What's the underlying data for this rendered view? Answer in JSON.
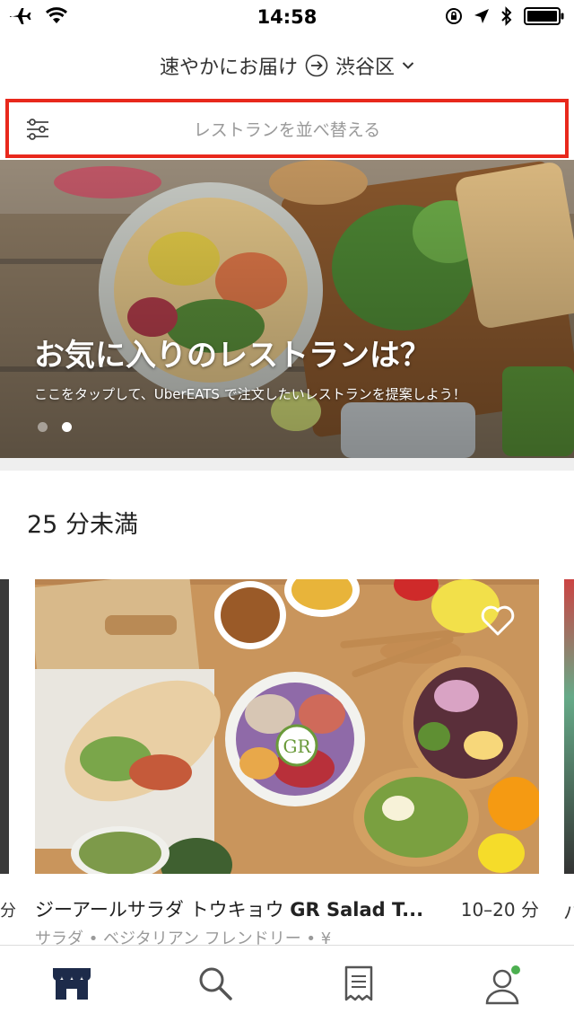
{
  "status_bar": {
    "time": "14:58"
  },
  "header": {
    "delivery_label": "速やかにお届け",
    "location": "渋谷区"
  },
  "search": {
    "placeholder": "レストランを並べ替える"
  },
  "banner": {
    "title": "お気に入りのレストランは？",
    "subtitle": "ここをタップして、UberEATS で注文したいレストランを提案しよう！"
  },
  "section": {
    "title": "25 分未満"
  },
  "restaurant": {
    "name_ja": "ジーアールサラダ トウキョウ ",
    "name_en": "GR Salad T...",
    "delivery_time": "10–20 分",
    "tags": "サラダ • ベジタリアン フレンドリー • ¥",
    "logo_text": "GR"
  },
  "stubs": {
    "left_text": "分",
    "right_text": "ハ"
  },
  "colors": {
    "highlight_border": "#e8281c",
    "notification_dot": "#4caf50"
  }
}
